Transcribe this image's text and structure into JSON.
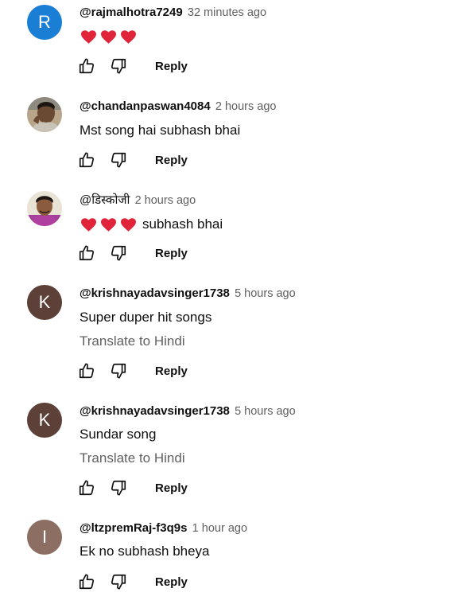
{
  "comments": [
    {
      "avatar_letter": "R",
      "avatar_color": "#1a7fd4",
      "handle": "@rajmalhotra7249",
      "time": "32 minutes ago",
      "text": "",
      "hearts": 3,
      "reply_label": "Reply"
    },
    {
      "avatar_type": "photo",
      "handle": "@chandanpaswan4084",
      "time": "2 hours ago",
      "text": "Mst song hai subhash bhai",
      "reply_label": "Reply"
    },
    {
      "avatar_type": "photo",
      "handle": "@डिस्कोजी",
      "time": "2 hours ago",
      "text": "subhash bhai",
      "hearts": 3,
      "reply_label": "Reply"
    },
    {
      "avatar_letter": "K",
      "avatar_color": "#5d4037",
      "handle": "@krishnayadavsinger1738",
      "time": "5 hours ago",
      "text": "Super duper hit songs",
      "translate_label": "Translate to Hindi",
      "reply_label": "Reply"
    },
    {
      "avatar_letter": "K",
      "avatar_color": "#5d4037",
      "handle": "@krishnayadavsinger1738",
      "time": "5 hours ago",
      "text": "Sundar song",
      "translate_label": "Translate to Hindi",
      "reply_label": "Reply"
    },
    {
      "avatar_letter": "I",
      "avatar_color": "#8d6e63",
      "handle": "@ltzpremRaj-f3q9s",
      "time": "1 hour ago",
      "text": "Ek no subhash bheya",
      "reply_label": "Reply"
    }
  ],
  "icons": {
    "like": "thumbs-up-icon",
    "dislike": "thumbs-down-icon",
    "heart": "red-heart-emoji"
  }
}
